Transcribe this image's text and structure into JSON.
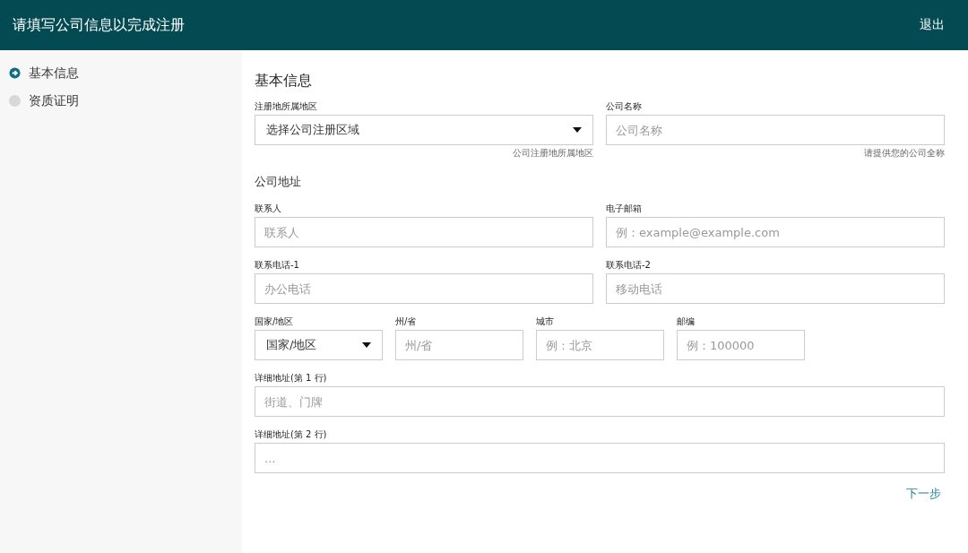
{
  "header": {
    "title": "请填写公司信息以完成注册",
    "logout": "退出"
  },
  "steps": [
    {
      "label": "基本信息",
      "selected": true
    },
    {
      "label": "资质证明",
      "selected": false
    }
  ],
  "form": {
    "title": "基本信息",
    "sections": [
      {
        "rows": [
          [
            {
              "kind": "select",
              "label": "注册地所属地区",
              "value": "选择公司注册区域",
              "hint": "公司注册地所属地区"
            },
            {
              "kind": "input",
              "label": "公司名称",
              "placeholder": "公司名称",
              "hint": "请提供您的公司全称"
            }
          ]
        ]
      },
      {
        "heading": "公司地址",
        "rows": [
          [
            {
              "kind": "input",
              "label": "联系人",
              "placeholder": "联系人"
            },
            {
              "kind": "input",
              "label": "电子邮箱",
              "placeholder": "例：example@example.com"
            }
          ],
          [
            {
              "kind": "input",
              "label": "联系电话-1",
              "placeholder": "办公电话"
            },
            {
              "kind": "input",
              "label": "联系电话-2",
              "placeholder": "移动电话"
            }
          ],
          [
            {
              "kind": "select",
              "label": "国家/地区",
              "value": "国家/地区"
            },
            {
              "kind": "input",
              "label": "州/省",
              "placeholder": "州/省"
            },
            {
              "kind": "input",
              "label": "城市",
              "placeholder": "例：北京"
            },
            {
              "kind": "input",
              "label": "邮编",
              "placeholder": "例：100000"
            }
          ],
          [
            {
              "kind": "input",
              "label": "详细地址(第 1 行)",
              "placeholder": "街道、门牌"
            }
          ],
          [
            {
              "kind": "input",
              "label": "详细地址(第 2 行)",
              "placeholder": "..."
            }
          ]
        ]
      }
    ],
    "next": "下一步"
  }
}
